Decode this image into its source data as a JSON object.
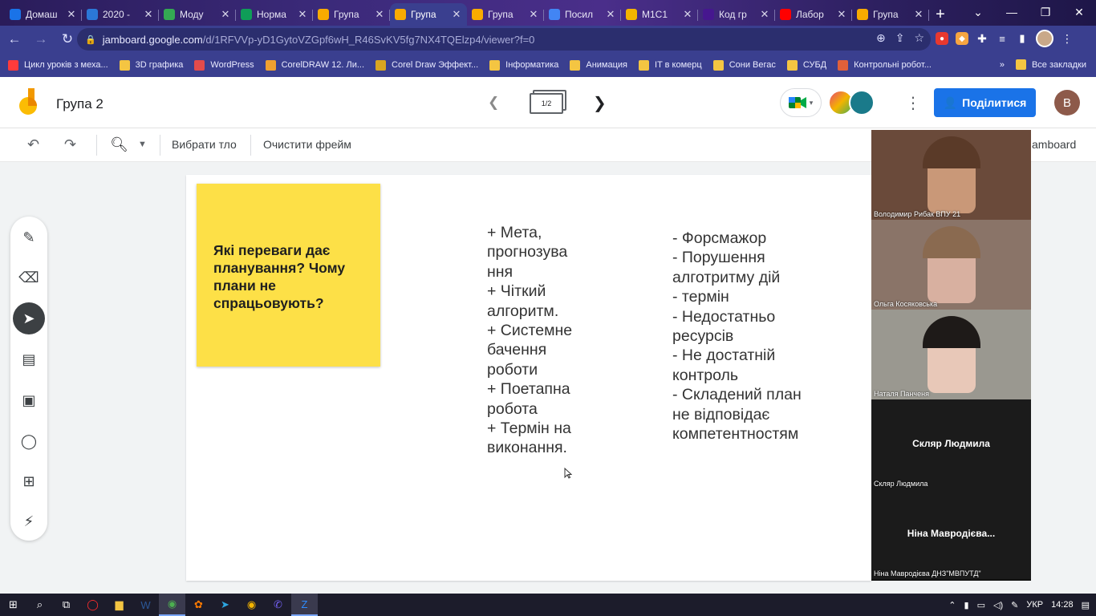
{
  "browser": {
    "tabs": [
      {
        "label": "Домаш",
        "fav": "video-icon",
        "color": "#1a73e8"
      },
      {
        "label": "2020 -",
        "fav": "globe-icon",
        "color": "#2b78d8"
      },
      {
        "label": "Моду",
        "fav": "drive-icon",
        "color": "#34a853"
      },
      {
        "label": "Норма",
        "fav": "sheets-icon",
        "color": "#0f9d58"
      },
      {
        "label": "Група",
        "fav": "jamboard-icon",
        "color": "#f9ab00"
      },
      {
        "label": "Група",
        "fav": "jamboard-icon",
        "color": "#f9ab00"
      },
      {
        "label": "Група",
        "fav": "jamboard-icon",
        "color": "#f9ab00"
      },
      {
        "label": "Посил",
        "fav": "docs-icon",
        "color": "#4285f4"
      },
      {
        "label": "М1С1",
        "fav": "slides-icon",
        "color": "#f4b400"
      },
      {
        "label": "Код гр",
        "fav": "kahoot-icon",
        "color": "#46178f"
      },
      {
        "label": "Лабор",
        "fav": "youtube-icon",
        "color": "#ff0000"
      },
      {
        "label": "Група",
        "fav": "jamboard-icon",
        "color": "#f9ab00"
      }
    ],
    "url_host": "jamboard.google.com",
    "url_path": "/d/1RFVVp-yD1GytoVZGpf6wH_R46SvKV5fg7NX4TQElzp4/viewer?f=0"
  },
  "bookmarks": {
    "items": [
      {
        "label": "Цикл уроків з меха...",
        "icon": "youtube-icon",
        "color": "#ff3b3b"
      },
      {
        "label": "3D графика",
        "icon": "folder-icon",
        "color": "#f4c542"
      },
      {
        "label": "WordPress",
        "icon": "wordpress-icon",
        "color": "#e34b4b"
      },
      {
        "label": "CorelDRAW 12. Ли...",
        "icon": "grid-icon",
        "color": "#f0a030"
      },
      {
        "label": "Corel Draw Эффект...",
        "icon": "coin-icon",
        "color": "#d9a520"
      },
      {
        "label": "Інформатика",
        "icon": "folder-icon",
        "color": "#f4c542"
      },
      {
        "label": "Анимация",
        "icon": "folder-icon",
        "color": "#f4c542"
      },
      {
        "label": "IT в комерц",
        "icon": "folder-icon",
        "color": "#f4c542"
      },
      {
        "label": "Сони Вегас",
        "icon": "folder-icon",
        "color": "#f4c542"
      },
      {
        "label": "СУБД",
        "icon": "folder-icon",
        "color": "#f4c542"
      },
      {
        "label": "Контрольні робот...",
        "icon": "page-icon",
        "color": "#e0603a"
      }
    ],
    "all": "Все закладки"
  },
  "jam": {
    "title": "Група 2",
    "frame": "1/2",
    "share": "Поділитися",
    "user_initial": "В",
    "choose_bg": "Вибрати тло",
    "clear_frame": "Очистити фрейм",
    "jam_link": "amboard"
  },
  "board": {
    "sticky": "Які переваги дає планування? Чому плани не спрацьовують?",
    "pros": [
      "+ Мета,",
      "прогнозува",
      "ння",
      "+ Чіткий",
      "алгоритм.",
      "+ Системне",
      "бачення",
      "роботи",
      "+ Поетапна",
      "робота",
      "+ Термін на",
      "виконання."
    ],
    "cons": [
      "- Форсмажор",
      "- Порушення",
      "алготритму дій",
      "- термін",
      "- Недостатньо",
      "ресурсів",
      "- Не достатній",
      "контроль",
      "- Складений план",
      "не відповідає",
      "компетентностям"
    ]
  },
  "video": {
    "participants": [
      {
        "name": "Володимир Рибак ВПУ 21",
        "center": "",
        "bg": "#6a4a3a"
      },
      {
        "name": "Ольга Косяковська",
        "center": "",
        "bg": "#8a7468"
      },
      {
        "name": "Наталя Панченя",
        "center": "",
        "bg": "#9a9890"
      },
      {
        "name": "Скляр Людмила",
        "center": "Скляр Людмила",
        "bg": "#1b1b1b"
      },
      {
        "name": "Ніна Мавродієва ДНЗ\"МВПУТД\"",
        "center": "Ніна Мавродієва...",
        "bg": "#1b1b1b"
      }
    ]
  },
  "taskbar": {
    "lang": "УКР",
    "time": "14:28"
  }
}
